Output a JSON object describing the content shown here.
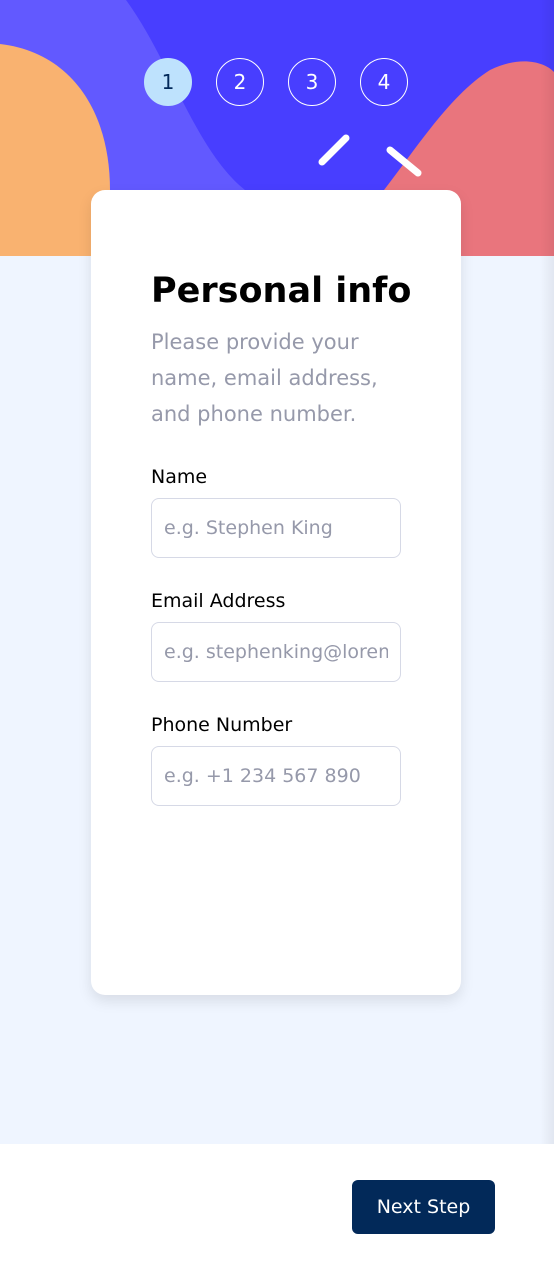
{
  "steps": [
    {
      "number": "1",
      "active": true
    },
    {
      "number": "2",
      "active": false
    },
    {
      "number": "3",
      "active": false
    },
    {
      "number": "4",
      "active": false
    }
  ],
  "colors": {
    "header_blue": "#483eff",
    "header_light_blue": "#6259ff",
    "orange_blob": "#f9b270",
    "pink_blob": "#e9757d",
    "active_step_bg": "#bee2fd",
    "next_button_bg": "#022959",
    "page_background": "#eff5ff"
  },
  "form": {
    "title": "Personal info",
    "description": "Please provide your name, email address, and phone number.",
    "fields": {
      "name": {
        "label": "Name",
        "placeholder": "e.g. Stephen King",
        "value": ""
      },
      "email": {
        "label": "Email Address",
        "placeholder": "e.g. stephenking@lorem.com",
        "value": ""
      },
      "phone": {
        "label": "Phone Number",
        "placeholder": "e.g. +1 234 567 890",
        "value": ""
      }
    }
  },
  "footer": {
    "next_label": "Next Step"
  }
}
